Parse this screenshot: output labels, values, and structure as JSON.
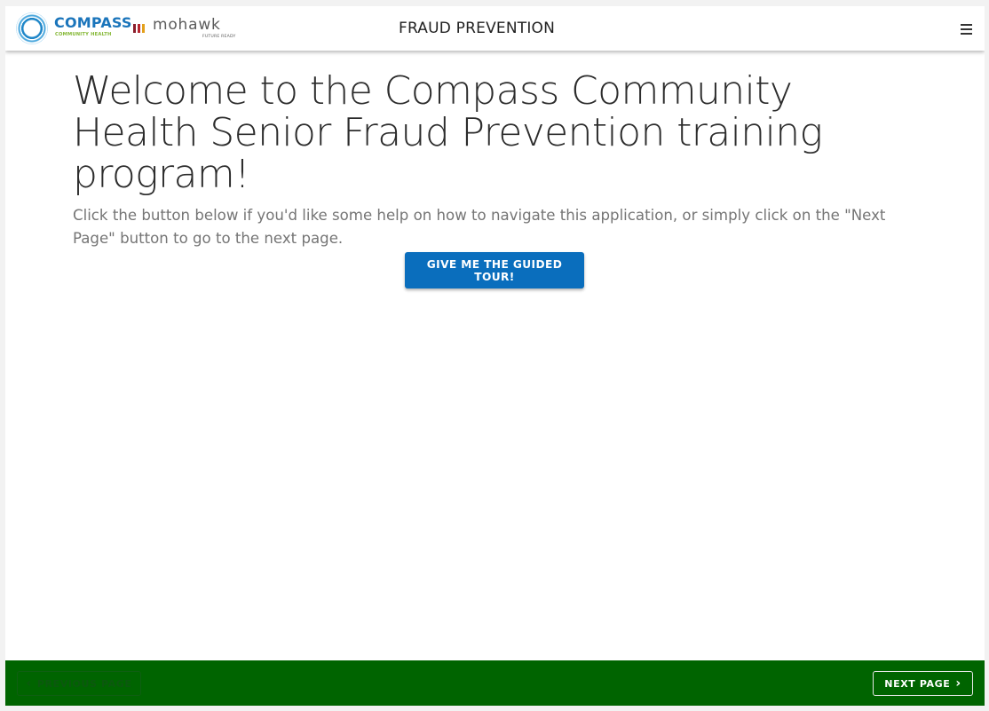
{
  "header": {
    "logos": {
      "compass_name": "COMPASS",
      "compass_sub": "COMMUNITY HEALTH",
      "mohawk_name": "mohawk",
      "mohawk_sub": "FUTURE READY"
    },
    "title": "FRAUD PREVENTION",
    "menu_icon": "hamburger-menu-icon"
  },
  "main": {
    "heading": "Welcome to the Compass Community Health Senior Fraud Prevention training program!",
    "intro": "Click the button below if you'd like some help on how to navigate this application, or simply click on the \"Next Page\" button to go to the next page.",
    "tour_button": "GIVE ME THE GUIDED TOUR!"
  },
  "footer": {
    "prev_label": "PREVIOUS PAGE",
    "prev_icon": "chevron-left-icon",
    "next_label": "NEXT PAGE",
    "next_icon": "chevron-right-icon"
  },
  "colors": {
    "accent_blue": "#0a6ebd",
    "footer_green": "#006400",
    "compass_blue": "#1b75bb",
    "compass_green": "#84b734"
  }
}
